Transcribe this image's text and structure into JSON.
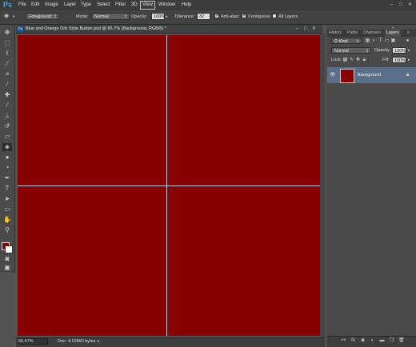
{
  "menubar": {
    "app_logo": "Ps",
    "items": [
      "File",
      "Edit",
      "Image",
      "Layer",
      "Type",
      "Select",
      "Filter",
      "3D",
      "View",
      "Window",
      "Help"
    ],
    "active_item": "View",
    "window_controls": {
      "minimize": "–",
      "maximize": "□",
      "close": "✕"
    }
  },
  "options_bar": {
    "tool_icon": "paint-bucket-icon",
    "fill_source": "Foreground",
    "mode_label": "Mode:",
    "mode_value": "Normal",
    "opacity_label": "Opacity:",
    "opacity_value": "100%",
    "tolerance_label": "Tolerance:",
    "tolerance_value": "32",
    "anti_alias_label": "Anti-alias",
    "anti_alias_checked": true,
    "contiguous_label": "Contiguous",
    "contiguous_checked": true,
    "all_layers_label": "All Layers",
    "all_layers_checked": false
  },
  "toolbar": {
    "tools": [
      {
        "name": "move-icon",
        "glyph": "✥"
      },
      {
        "name": "marquee-icon",
        "glyph": "⬚"
      },
      {
        "name": "lasso-icon",
        "glyph": "ℓ"
      },
      {
        "name": "magic-wand-icon",
        "glyph": "⁄"
      },
      {
        "name": "crop-icon",
        "glyph": "⌗"
      },
      {
        "name": "eyedropper-icon",
        "glyph": "⁄"
      },
      {
        "name": "healing-brush-icon",
        "glyph": "✚"
      },
      {
        "name": "brush-icon",
        "glyph": "⁄"
      },
      {
        "name": "clone-stamp-icon",
        "glyph": "⊥"
      },
      {
        "name": "history-brush-icon",
        "glyph": "↺"
      },
      {
        "name": "eraser-icon",
        "glyph": "▱"
      },
      {
        "name": "paint-bucket-icon",
        "glyph": "◈"
      },
      {
        "name": "blur-icon",
        "glyph": "●"
      },
      {
        "name": "dodge-icon",
        "glyph": "◔"
      },
      {
        "name": "pen-icon",
        "glyph": "✒"
      },
      {
        "name": "type-icon",
        "glyph": "T"
      },
      {
        "name": "path-selection-icon",
        "glyph": "➤"
      },
      {
        "name": "shape-icon",
        "glyph": "▭"
      },
      {
        "name": "hand-icon",
        "glyph": "✋"
      },
      {
        "name": "zoom-icon",
        "glyph": "⚲"
      }
    ],
    "selected_tool": "paint-bucket-icon",
    "foreground_color": "#8a0000",
    "background_color": "#ffffff",
    "quick_mask_icon": "quick-mask-icon",
    "screen_mode_icon": "screen-mode-icon"
  },
  "document": {
    "tab_icon_text": "Ps",
    "title": "Blue and Orange Orb Style Button.psd @ 66.7% (Background, RGB/8) *",
    "canvas_color": "#880000",
    "guide_color": "#b5d0df",
    "zoom": "66.67%",
    "doc_size": "Doc: 4.12M/0 bytes",
    "status_arrow": "▸"
  },
  "panels": {
    "collapse_icon": "»",
    "tabs": [
      "History",
      "Paths",
      "Channels",
      "Layers"
    ],
    "active_tab": "Layers",
    "menu_icon": "≡",
    "kind_label": "Kind",
    "blend_mode": "Normal",
    "opacity_label": "Opacity:",
    "opacity_value": "100%",
    "lock_label": "Lock:",
    "fill_label": "Fill:",
    "fill_value": "100%",
    "layers": [
      {
        "name": "Background",
        "thumb_color": "#880000",
        "visible": true,
        "locked": true
      }
    ],
    "footer_icons": [
      "link-icon",
      "fx-icon",
      "mask-icon",
      "adjustment-icon",
      "folder-icon",
      "new-layer-icon",
      "trash-icon"
    ]
  }
}
